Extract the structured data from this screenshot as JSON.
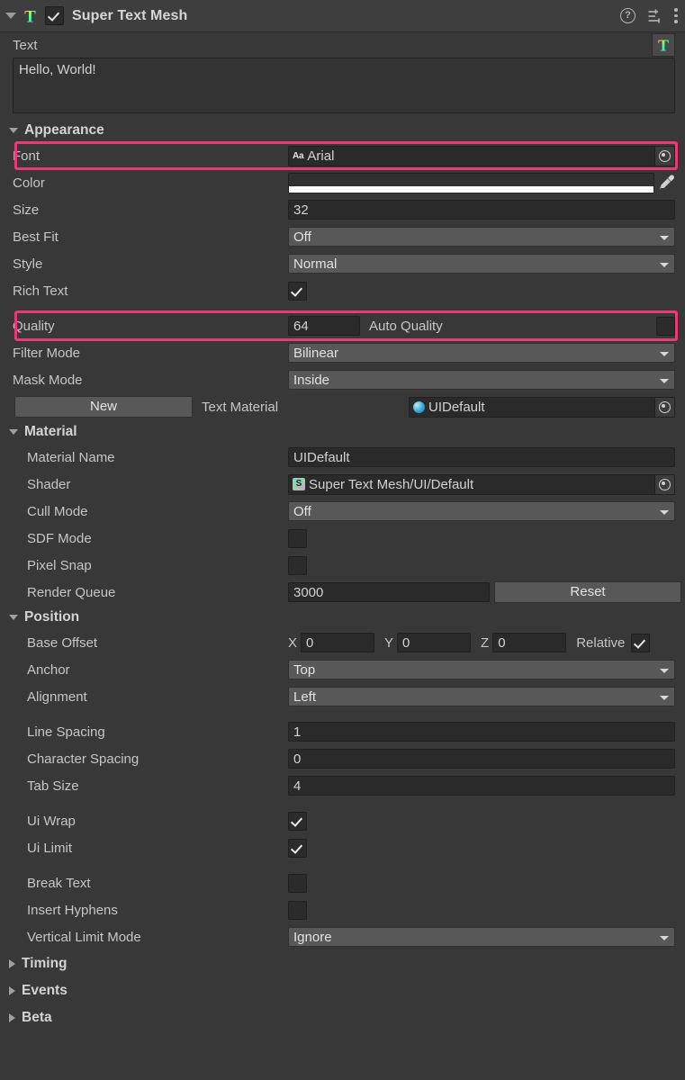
{
  "header": {
    "title": "Super Text Mesh",
    "enabled": true,
    "expanded": true,
    "icons": {
      "component": "super-text-mesh-icon",
      "help": "?",
      "preset": "preset-icon",
      "menu": "kebab-menu-icon"
    }
  },
  "text_section": {
    "label": "Text",
    "value": "Hello, World!",
    "thumbnail": "super-text-mesh-thumbnail"
  },
  "appearance": {
    "title": "Appearance",
    "expanded": true,
    "font": {
      "label": "Font",
      "badge": "Aa",
      "value": "Arial",
      "highlighted": true
    },
    "color": {
      "label": "Color",
      "swatch": "#ffffff"
    },
    "size": {
      "label": "Size",
      "value": "32"
    },
    "best_fit": {
      "label": "Best Fit",
      "value": "Off"
    },
    "style": {
      "label": "Style",
      "value": "Normal"
    },
    "rich_text": {
      "label": "Rich Text",
      "checked": true
    },
    "quality": {
      "label": "Quality",
      "value": "64",
      "auto_label": "Auto Quality",
      "auto_checked": false,
      "highlighted": true
    },
    "filter_mode": {
      "label": "Filter Mode",
      "value": "Bilinear"
    },
    "mask_mode": {
      "label": "Mask Mode",
      "value": "Inside"
    },
    "text_material": {
      "new_button": "New",
      "label": "Text Material",
      "value": "UIDefault"
    }
  },
  "material": {
    "title": "Material",
    "expanded": true,
    "material_name": {
      "label": "Material Name",
      "value": "UIDefault"
    },
    "shader": {
      "label": "Shader",
      "value": "Super Text Mesh/UI/Default"
    },
    "cull_mode": {
      "label": "Cull Mode",
      "value": "Off"
    },
    "sdf_mode": {
      "label": "SDF Mode",
      "checked": false
    },
    "pixel_snap": {
      "label": "Pixel Snap",
      "checked": false
    },
    "render_queue": {
      "label": "Render Queue",
      "value": "3000",
      "reset_button": "Reset"
    }
  },
  "position": {
    "title": "Position",
    "expanded": true,
    "base_offset": {
      "label": "Base Offset",
      "x_axis": "X",
      "x": "0",
      "y_axis": "Y",
      "y": "0",
      "z_axis": "Z",
      "z": "0",
      "relative_label": "Relative",
      "relative_checked": true
    },
    "anchor": {
      "label": "Anchor",
      "value": "Top"
    },
    "alignment": {
      "label": "Alignment",
      "value": "Left"
    },
    "line_spacing": {
      "label": "Line Spacing",
      "value": "1"
    },
    "character_spacing": {
      "label": "Character Spacing",
      "value": "0"
    },
    "tab_size": {
      "label": "Tab Size",
      "value": "4"
    },
    "ui_wrap": {
      "label": "Ui Wrap",
      "checked": true
    },
    "ui_limit": {
      "label": "Ui Limit",
      "checked": true
    },
    "break_text": {
      "label": "Break Text",
      "checked": false
    },
    "insert_hyphens": {
      "label": "Insert Hyphens",
      "checked": false
    },
    "vertical_limit_mode": {
      "label": "Vertical Limit Mode",
      "value": "Ignore"
    }
  },
  "collapsed_sections": [
    {
      "title": "Timing",
      "expanded": false
    },
    {
      "title": "Events",
      "expanded": false
    },
    {
      "title": "Beta",
      "expanded": false
    }
  ],
  "colors": {
    "background": "#383838",
    "header_bar": "#3e3e3e",
    "input_bg": "#2a2a2a",
    "dropdown_bg": "#585858",
    "highlight": "#e63b78",
    "text": "#c9c9c9"
  }
}
